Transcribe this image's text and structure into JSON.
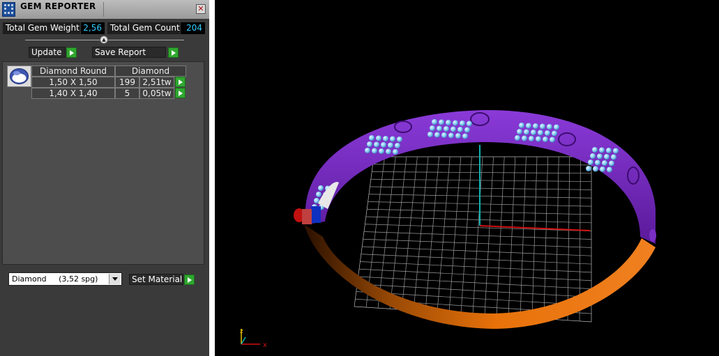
{
  "panel": {
    "title": "GEM REPORTER",
    "close_label": "✕",
    "total_weight_label": "Total Gem Weight",
    "total_weight_value": "2,56",
    "total_count_label": "Total Gem Count",
    "total_count_value": "204",
    "update_label": "Update",
    "save_report_label": "Save Report",
    "table": {
      "headers": [
        "Diamond Round",
        "Diamond"
      ],
      "rows": [
        {
          "size": "1,50 X 1,50",
          "count": "199",
          "weight": "2,51tw"
        },
        {
          "size": "1,40 X 1,40",
          "count": "5",
          "weight": "0,05tw"
        }
      ]
    },
    "material": {
      "selected_name": "Diamond",
      "selected_spg": "(3,52 spg)",
      "set_material_label": "Set Material"
    }
  },
  "viewport": {
    "axis_x_label": "x",
    "axis_z_label": "z",
    "colors": {
      "band_top": "#7b2fc4",
      "band_bottom": "#e8720a",
      "gems": "#7fc7f0",
      "grid": "#9a9a9a",
      "axis_x": "#d01010",
      "axis_y": "#10b0b0"
    }
  }
}
